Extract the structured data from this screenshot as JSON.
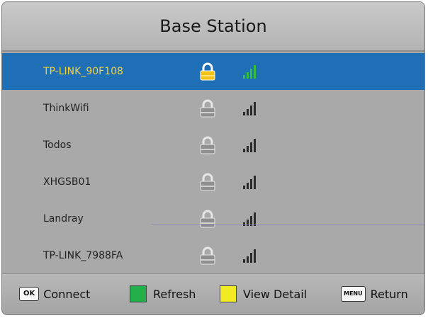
{
  "header": {
    "title": "Base Station"
  },
  "networks": [
    {
      "ssid": "TP-LINK_90F108",
      "selected": true
    },
    {
      "ssid": "ThinkWifi",
      "selected": false
    },
    {
      "ssid": "Todos",
      "selected": false
    },
    {
      "ssid": "XHGSB01",
      "selected": false
    },
    {
      "ssid": "Landray",
      "selected": false
    },
    {
      "ssid": "TP-LINK_7988FA",
      "selected": false
    }
  ],
  "icons": {
    "lock": "lock-icon",
    "signal": "signal-strength-icon"
  },
  "colors": {
    "selection": "#1f6fb7",
    "selected_text": "#f3d23a",
    "lock_selected": "#f2c316",
    "signal_selected": "#33c03a",
    "refresh_key": "#23b04a",
    "view_detail_key": "#f2ea25"
  },
  "footer": {
    "ok_key": "OK",
    "connect_label": "Connect",
    "refresh_label": "Refresh",
    "view_detail_label": "View Detail",
    "menu_key": "MENU",
    "return_label": "Return"
  }
}
